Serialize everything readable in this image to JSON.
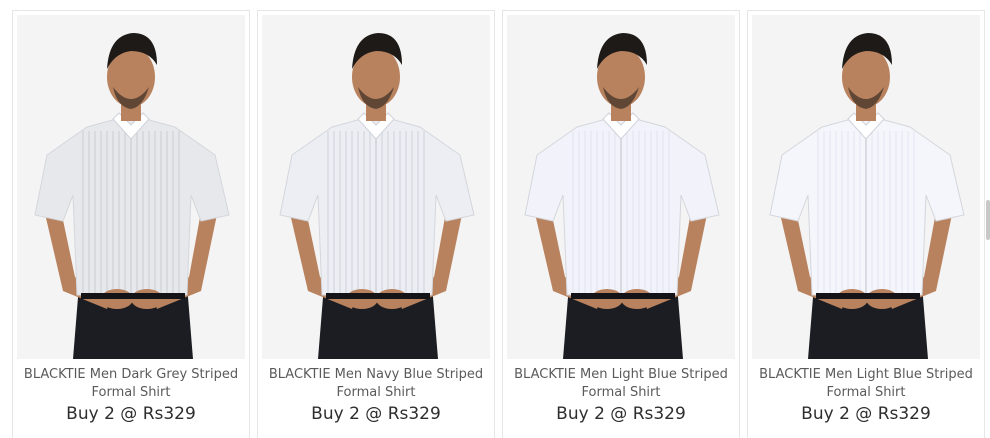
{
  "products": [
    {
      "title_line1": "BLACKTIE Men Dark Grey Striped",
      "title_line2": "Formal Shirt",
      "price": "Buy 2 @ Rs329",
      "shirt_color": "#e7e8ec",
      "stripe_color": "#c9ccd3"
    },
    {
      "title_line1": "BLACKTIE Men Navy Blue Striped",
      "title_line2": "Formal Shirt",
      "price": "Buy 2 @ Rs329",
      "shirt_color": "#eceef3",
      "stripe_color": "#cfd3dd"
    },
    {
      "title_line1": "BLACKTIE Men Light Blue Striped",
      "title_line2": "Formal Shirt",
      "price": "Buy 2 @ Rs329",
      "shirt_color": "#f2f3fa",
      "stripe_color": "#dde0ee"
    },
    {
      "title_line1": "BLACKTIE Men Light Blue Striped",
      "title_line2": "Formal Shirt",
      "price": "Buy 2 @ Rs329",
      "shirt_color": "#f5f6fc",
      "stripe_color": "#e2e4f1"
    }
  ],
  "colors": {
    "skin": "#b9825e",
    "hair": "#1e1a18",
    "trousers": "#1c1d22",
    "background": "#f4f4f4"
  }
}
